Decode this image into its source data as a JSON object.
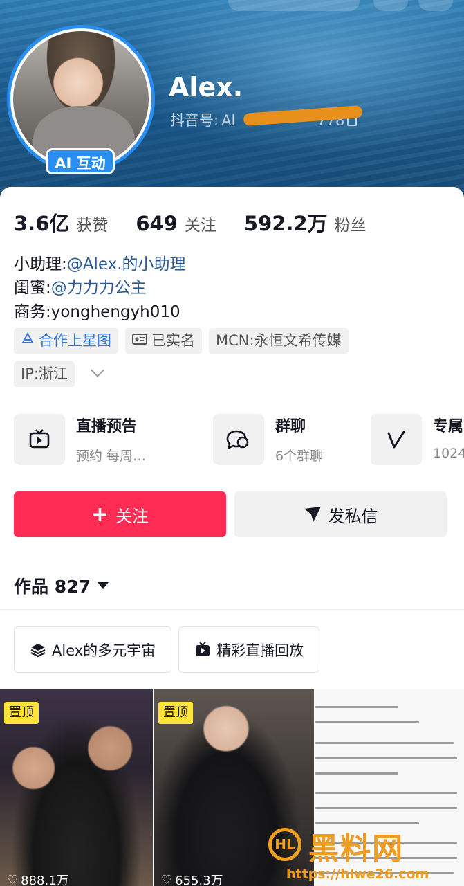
{
  "profile": {
    "nickname": "Alex.",
    "douyin_label": "抖音号:",
    "douyin_id_visible": "Al",
    "douyin_id_tail": "778",
    "ai_badge": "AI 互动"
  },
  "stats": [
    {
      "value": "3.6亿",
      "label": "获赞"
    },
    {
      "value": "649",
      "label": "关注"
    },
    {
      "value": "592.2万",
      "label": "粉丝"
    }
  ],
  "info": {
    "assistant_label": "小助理:",
    "assistant_link": "@Alex.的小助理",
    "bestie_label": "闺蜜:",
    "bestie_link": "@力力力公主",
    "business_label": "商务:",
    "business_value": "yonghengyh010"
  },
  "tags": {
    "star_map": "合作上星图",
    "verified": "已实名",
    "mcn": "MCN:永恒文希传媒",
    "ip": "IP:浙江"
  },
  "cards": [
    {
      "title": "直播预告",
      "sub": "预约 每周…",
      "icon": "tv-icon"
    },
    {
      "title": "群聊",
      "sub": "6个群聊",
      "icon": "chat-bubbles-icon"
    },
    {
      "title": "专属",
      "sub": "1024",
      "icon": "v-logo-icon"
    }
  ],
  "actions": {
    "follow_plus": "+",
    "follow": "关注",
    "message": "发私信"
  },
  "works": {
    "label": "作品 827"
  },
  "chips": {
    "universe": "Alex的多元宇宙",
    "live_replay": "精彩直播回放"
  },
  "thumbs": [
    {
      "pin": "置顶",
      "likes": "888.1万"
    },
    {
      "pin": "置顶",
      "likes": "655.3万"
    }
  ],
  "watermark": {
    "logo": "HL",
    "text": "黑料网",
    "url": "https://hlwe26.com"
  },
  "colors": {
    "accent": "#fe2c55",
    "avatar_ring": "#2a8df0",
    "link": "#2a5a9a",
    "pin": "#ffe23a"
  }
}
